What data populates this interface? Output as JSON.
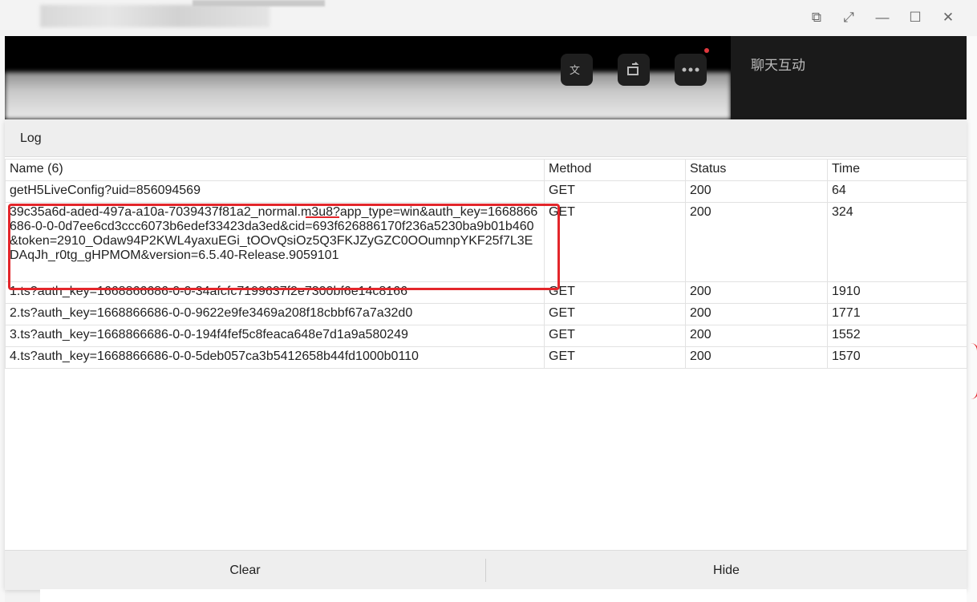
{
  "window": {
    "controls": {
      "pip_icon": "⧉",
      "expand_icon": "⤢",
      "minimize_icon": "—",
      "maximize_icon": "☐",
      "close_icon": "✕"
    }
  },
  "video": {
    "chat_label": "聊天互动",
    "icons": [
      "translate-icon",
      "rotate-icon",
      "more-icon"
    ]
  },
  "log": {
    "title": "Log",
    "columns": {
      "name": "Name (6)",
      "method": "Method",
      "status": "Status",
      "time": "Time"
    },
    "rows": [
      {
        "name": "getH5LiveConfig?uid=856094569",
        "method": "GET",
        "status": "200",
        "time": "64"
      },
      {
        "name": "39c35a6d-aded-497a-a10a-7039437f81a2_normal.m3u8?app_type=win&auth_key=1668866686-0-0-0d7ee6cd3ccc6073b6edef33423da3ed&cid=693f626886170f236a5230ba9b01b460&token=2910_Odaw94P2KWL4yaxuEGi_tOOvQsiOz5Q3FKJZyGZC0OOumnpYKF25f7L3EDAqJh_r0tg_gHPMOM&version=6.5.40-Release.9059101",
        "method": "GET",
        "status": "200",
        "time": "324"
      },
      {
        "name": "1.ts?auth_key=1668866686-0-0-34afcfc7199637f2e7300bf6e14c8166",
        "method": "GET",
        "status": "200",
        "time": "1910"
      },
      {
        "name": "2.ts?auth_key=1668866686-0-0-9622e9fe3469a208f18cbbf67a7a32d0",
        "method": "GET",
        "status": "200",
        "time": "1771"
      },
      {
        "name": "3.ts?auth_key=1668866686-0-0-194f4fef5c8feaca648e7d1a9a580249",
        "method": "GET",
        "status": "200",
        "time": "1552"
      },
      {
        "name": "4.ts?auth_key=1668866686-0-0-5deb057ca3b5412658b44fd1000b0110",
        "method": "GET",
        "status": "200",
        "time": "1570"
      }
    ],
    "footer": {
      "clear_label": "Clear",
      "hide_label": "Hide"
    }
  },
  "colors": {
    "highlight": "#e3262b",
    "panel_bg": "#ffffff",
    "header_bg": "#eeeeee"
  }
}
